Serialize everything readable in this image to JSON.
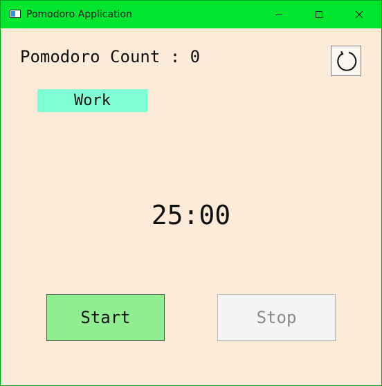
{
  "window": {
    "title": "Pomodoro Application",
    "titlebar_color": "#00e52e"
  },
  "icons": {
    "app": "app-window-icon",
    "minimize": "minimize-icon",
    "maximize": "maximize-icon",
    "close": "close-icon",
    "reset": "refresh-icon"
  },
  "counter": {
    "label": "Pomodoro Count : 0"
  },
  "mode": {
    "label": "Work",
    "color": "#7fffd4"
  },
  "timer": {
    "display": "25:00"
  },
  "controls": {
    "start_label": "Start",
    "start_color": "#90ee90",
    "stop_label": "Stop",
    "stop_state": "disabled"
  },
  "colors": {
    "background": "#fcebd8"
  }
}
